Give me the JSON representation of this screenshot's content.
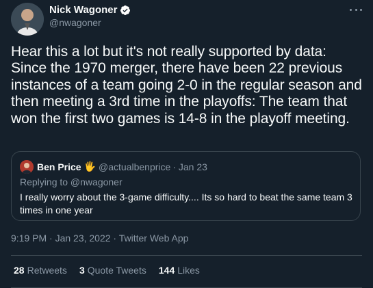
{
  "author": {
    "name": "Nick Wagoner",
    "handle": "@nwagoner"
  },
  "tweet": {
    "text": "Hear this a lot but it's not really supported by data: Since the 1970 merger, there have been 22 previous instances of a team going 2-0 in the regular season and then meeting a 3rd time in the playoffs: The team that  won the first two games is 14-8 in the playoff meeting.",
    "timestamp": "9:19 PM · Jan 23, 2022 · Twitter Web App"
  },
  "quote": {
    "name": "Ben Price",
    "emoji": "🖐",
    "handle": "@actualbenprice",
    "date": "· Jan 23",
    "reply_to": "Replying to @nwagoner",
    "text": "I really worry about the 3-game difficulty.... Its so hard to beat the same team 3 times in one year"
  },
  "stats": [
    {
      "count": "28",
      "label": "Retweets"
    },
    {
      "count": "3",
      "label": "Quote Tweets"
    },
    {
      "count": "144",
      "label": "Likes"
    }
  ],
  "icons": {
    "verified": "verified-icon",
    "more": "more-icon"
  },
  "colors": {
    "background": "#15202b",
    "text": "#f7f9f9",
    "secondary": "#8b98a5",
    "border": "#38444d",
    "verified": "#ffffff"
  }
}
